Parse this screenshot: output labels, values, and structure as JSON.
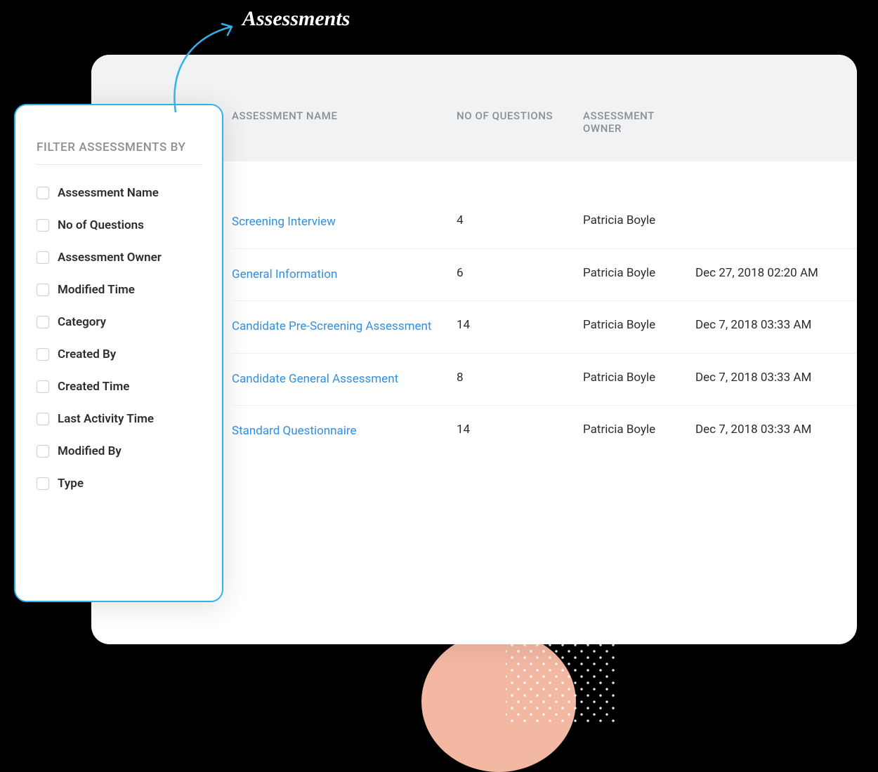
{
  "annotation": {
    "label": "Assessments"
  },
  "filter": {
    "title": "FILTER ASSESSMENTS BY",
    "items": [
      {
        "label": "Assessment Name"
      },
      {
        "label": "No of Questions"
      },
      {
        "label": "Assessment Owner"
      },
      {
        "label": "Modified Time"
      },
      {
        "label": "Category"
      },
      {
        "label": "Created By"
      },
      {
        "label": "Created Time"
      },
      {
        "label": "Last Activity Time"
      },
      {
        "label": "Modified By"
      },
      {
        "label": "Type"
      }
    ]
  },
  "table": {
    "headers": {
      "name": "ASSESSMENT NAME",
      "questions": "NO OF QUESTIONS",
      "owner": "ASSESSMENT OWNER"
    },
    "rows": [
      {
        "name": "Screening Interview",
        "questions": "4",
        "owner": "Patricia Boyle",
        "time": ""
      },
      {
        "name": "General Information",
        "questions": "6",
        "owner": "Patricia Boyle",
        "time": "Dec 27, 2018 02:20 AM"
      },
      {
        "name": "Candidate Pre-Screening Assessment",
        "questions": "14",
        "owner": "Patricia Boyle",
        "time": "Dec 7, 2018 03:33 AM"
      },
      {
        "name": "Candidate General Assessment",
        "questions": "8",
        "owner": "Patricia Boyle",
        "time": "Dec 7, 2018 03:33 AM"
      },
      {
        "name": "Standard Questionnaire",
        "questions": "14",
        "owner": "Patricia Boyle",
        "time": "Dec 7, 2018 03:33 AM"
      }
    ]
  }
}
